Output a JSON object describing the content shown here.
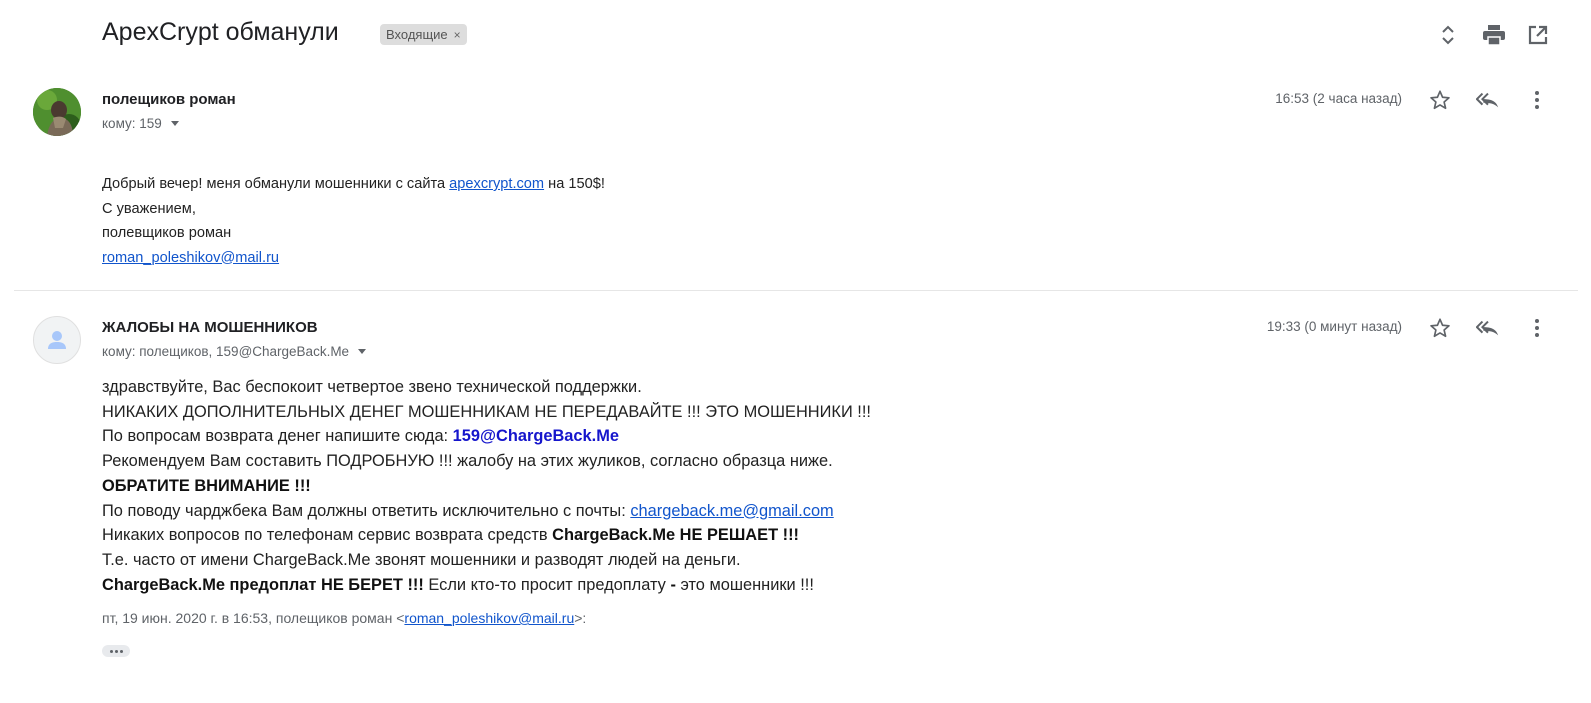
{
  "header": {
    "subject": "ApexCrypt обманули",
    "label": "Входящие",
    "label_remove": "×",
    "icons": [
      "expand-collapse-icon",
      "print-icon",
      "open-new-window-icon"
    ]
  },
  "messages": [
    {
      "sender": "полещиков роман",
      "recipient": "кому: 159",
      "time": "16:53 (2 часа назад)",
      "avatar": "photo",
      "body": {
        "l1_pre": "Добрый вечер! меня обманули мошенники с сайта ",
        "l1_link": "apexcrypt.com",
        "l1_post": " на 150$!",
        "l2": "С уважением,",
        "l3": "полевщиков роман",
        "l4_link": "roman_poleshikov@mail.ru"
      }
    },
    {
      "sender": "ЖАЛОБЫ НА МОШЕННИКОВ",
      "recipient": "кому: полещиков, 159@ChargeBack.Me",
      "time": "19:33 (0 минут назад)",
      "avatar": "default-person",
      "body": {
        "l1": "здравствуйте, Вас беспокоит четвертое звено технической поддержки.",
        "l2": "НИКАКИХ ДОПОЛНИТЕЛЬНЫХ ДЕНЕГ МОШЕННИКАМ НЕ ПЕРЕДАВАЙТЕ !!! ЭТО МОШЕННИКИ !!!",
        "l3_pre": "По вопросам возврата денег напишите сюда: ",
        "l3_bold": "159@ChargeBack.Me",
        "l4": "Рекомендуем Вам составить ПОДРОБНУЮ !!! жалобу на этих жуликов, согласно образца ниже.",
        "l5_bold": "ОБРАТИТЕ ВНИМАНИЕ !!!",
        "l6_pre": "По поводу чарджбека Вам должны ответить исключительно с почты: ",
        "l6_link": "chargeback.me@gmail.com",
        "l7_pre": "Никаких вопросов по телефонам сервис возврата средств ",
        "l7_bold": "ChargeBack.Me НЕ РЕШАЕТ !!!",
        "l8": "Т.е. часто от имени ChargeBack.Me звонят мошенники и разводят людей на деньги.",
        "l9_bold": "ChargeBack.Me предоплат НЕ БЕРЕТ !!!",
        "l9_mid": " Если кто-то просит предоплату ",
        "l9_bold2": "-",
        "l9_post": " это мошенники !!!"
      },
      "quote": {
        "pre": "пт, 19 июн. 2020 г. в 16:53, полещиков роман <",
        "link": "roman_poleshikov@mail.ru",
        "post": ">:"
      }
    }
  ],
  "colors": {
    "link": "#1155cc",
    "label_chip_bg": "#dddddd",
    "secondary_text": "#5f6368"
  }
}
